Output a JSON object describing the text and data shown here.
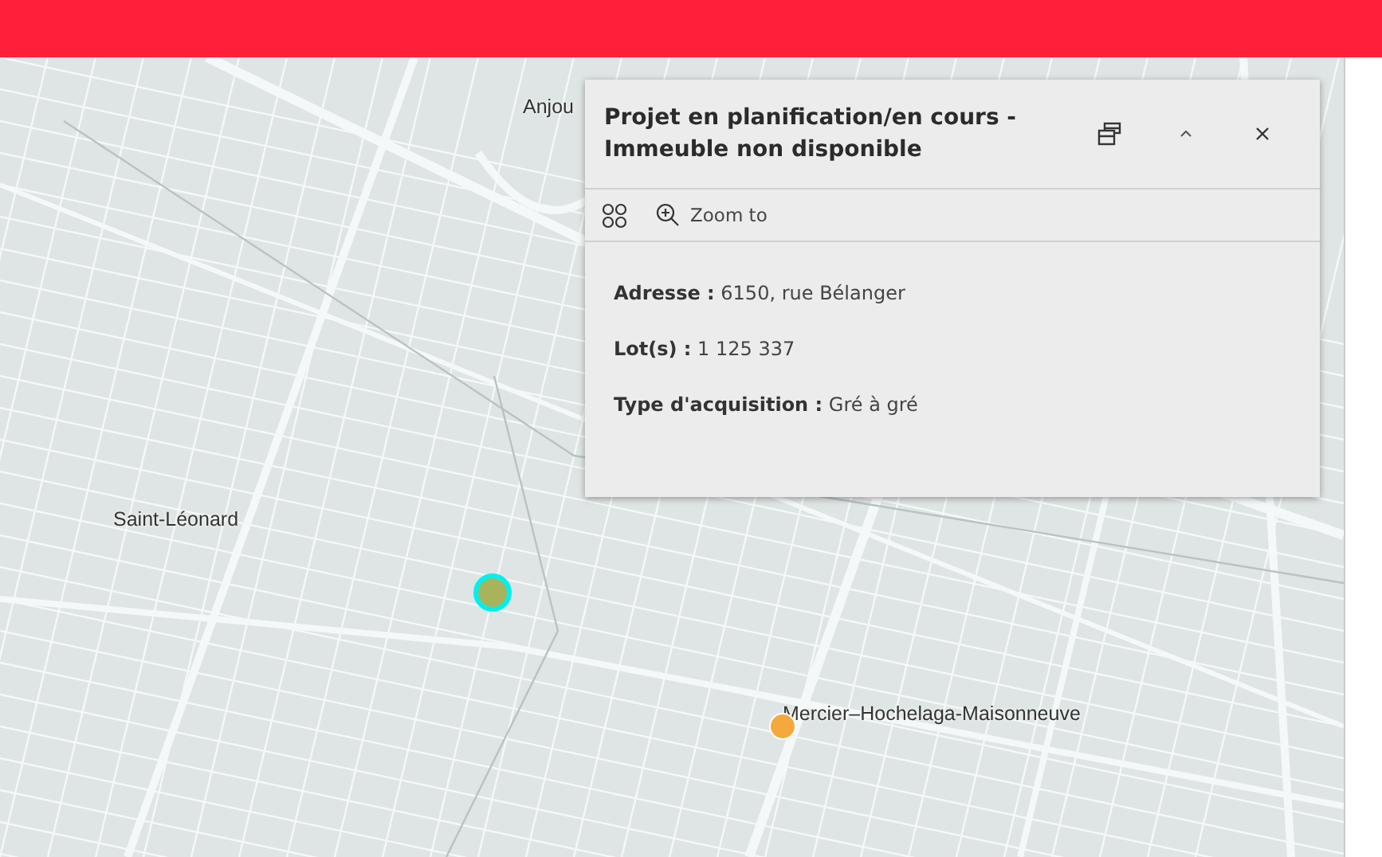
{
  "map": {
    "labels": [
      "Anjou",
      "Saint-Léonard",
      "Mercier–Hochelaga-Maisonneuve"
    ],
    "markers": [
      {
        "color": "#a8b45c",
        "selected": true
      },
      {
        "color": "#f5a93c",
        "selected": false
      }
    ]
  },
  "popup": {
    "title": "Projet en planification/en cours - Immeuble non disponible",
    "zoom_button": "Zoom to",
    "fields": [
      {
        "label": "Adresse :",
        "value": "6150, rue Bélanger"
      },
      {
        "label": "Lot(s) :",
        "value": "1 125 337"
      },
      {
        "label": "Type d'acquisition :",
        "value": "Gré à gré"
      }
    ]
  }
}
